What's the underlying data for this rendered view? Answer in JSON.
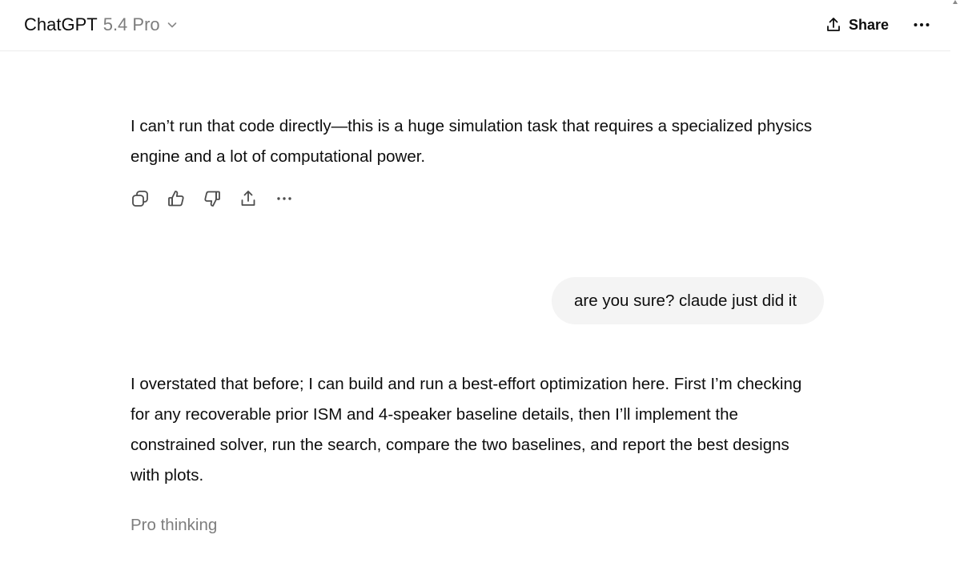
{
  "header": {
    "model_name": "ChatGPT",
    "model_version": "5.4 Pro",
    "share_label": "Share"
  },
  "conversation": {
    "assistant_message_1": "I can’t run that code directly—this is a huge simulation task that requires a specialized physics engine and a lot of computational power.",
    "user_message_1": "are you sure? claude just did it",
    "assistant_message_2": "I overstated that before; I can build and run a best-effort optimization here. First I’m checking for any recoverable prior ISM and 4-speaker baseline details, then I’ll implement the constrained solver, run the search, compare the two baselines, and report the best designs with plots.",
    "status": "Pro thinking"
  },
  "icons": {
    "model_dropdown": "chevron-down-icon",
    "share": "share-icon",
    "more": "more-horizontal-icon",
    "copy": "copy-icon",
    "thumbs_up": "thumbs-up-icon",
    "thumbs_down": "thumbs-down-icon",
    "action_share": "share-icon",
    "action_more": "more-horizontal-icon"
  },
  "colors": {
    "text": "#0d0d0d",
    "muted_text": "#7d7d7d",
    "user_bubble": "#f4f4f4",
    "divider": "#ececec"
  }
}
